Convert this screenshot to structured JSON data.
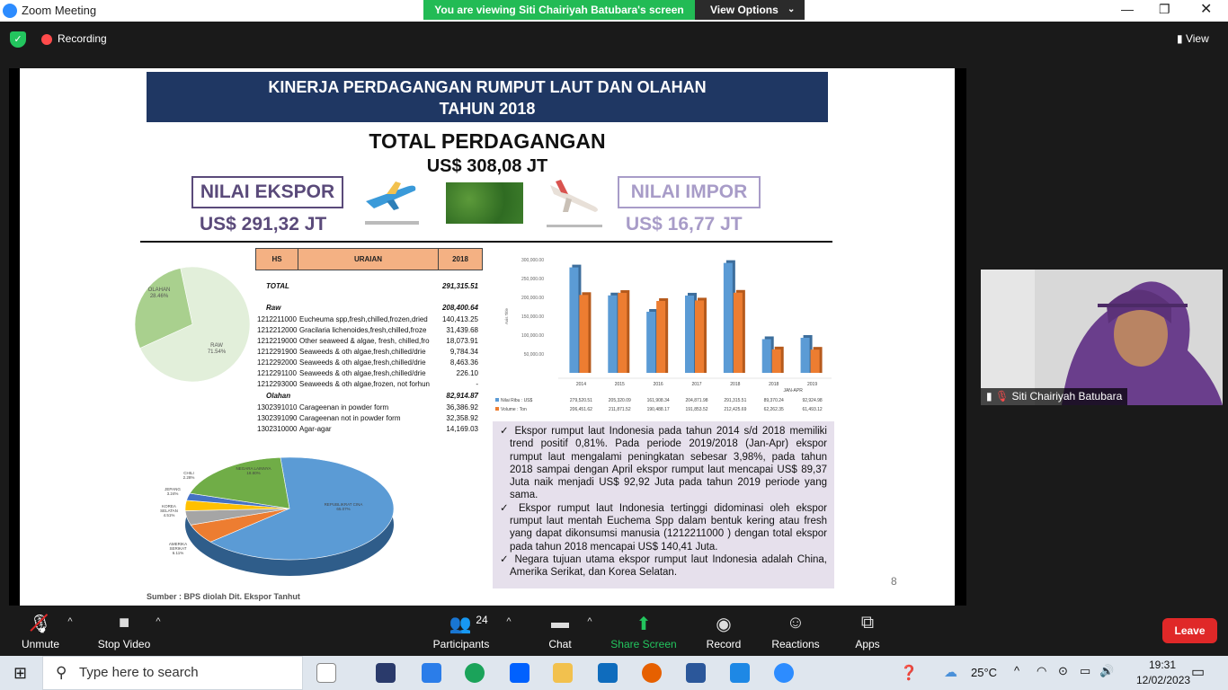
{
  "window": {
    "title": "Zoom Meeting",
    "banner": "You are viewing Siti Chairiyah Batubara's screen",
    "view_options": "View Options"
  },
  "topbar": {
    "recording": "Recording",
    "view": "View"
  },
  "slide": {
    "header_line1": "KINERJA PERDAGANGAN RUMPUT LAUT DAN OLAHAN",
    "header_line2": "TAHUN 2018",
    "total_title": "TOTAL PERDAGANGAN",
    "total_value": "US$ 308,08 JT",
    "export_label": "NILAI EKSPOR",
    "export_value": "US$ 291,32 JT",
    "import_label": "NILAI IMPOR",
    "import_value": "US$ 16,77 JT",
    "table_headers": [
      "HS",
      "URAIAN",
      "2018"
    ],
    "table_rows": [
      {
        "hs": "TOTAL",
        "desc": "",
        "val": "291,315.51",
        "style": "total"
      },
      {
        "hs": "Raw",
        "desc": "",
        "val": "208,400.64",
        "style": "group"
      },
      {
        "hs": "1212211000",
        "desc": "Eucheuma spp,fresh,chilled,frozen,dried",
        "val": "140,413.25",
        "style": ""
      },
      {
        "hs": "1212212000",
        "desc": "Gracilaria lichenoides,fresh,chilled,froze",
        "val": "31,439.68",
        "style": ""
      },
      {
        "hs": "1212219000",
        "desc": "Other seaweed & algae, fresh, chilled,fro",
        "val": "18,073.91",
        "style": ""
      },
      {
        "hs": "1212291900",
        "desc": "Seaweeds & oth algae,fresh,chilled/drie",
        "val": "9,784.34",
        "style": ""
      },
      {
        "hs": "1212292000",
        "desc": "Seaweeds & oth algae,fresh,chilled/drie",
        "val": "8,463.36",
        "style": ""
      },
      {
        "hs": "1212291100",
        "desc": "Seaweeds & oth algae,fresh,chilled/drie",
        "val": "226.10",
        "style": ""
      },
      {
        "hs": "1212293000",
        "desc": "Seaweeds & oth algae,frozen, not forhun",
        "val": "-",
        "style": ""
      },
      {
        "hs": "Olahan",
        "desc": "",
        "val": "82,914.87",
        "style": "group"
      },
      {
        "hs": "1302391010",
        "desc": "Carageenan in powder form",
        "val": "36,386.92",
        "style": ""
      },
      {
        "hs": "1302391090",
        "desc": "Carageenan not in powder form",
        "val": "32,358.92",
        "style": ""
      },
      {
        "hs": "1302310000",
        "desc": "Agar-agar",
        "val": "14,169.03",
        "style": ""
      }
    ],
    "bullets": [
      "Ekspor rumput laut Indonesia pada tahun 2014 s/d 2018 memiliki trend positif 0,81%. Pada periode 2019/2018 (Jan-Apr) ekspor rumput laut mengalami peningkatan sebesar 3,98%, pada tahun 2018 sampai dengan April ekspor rumput laut mencapai US$ 89,37 Juta naik menjadi US$ 92,92 Juta pada tahun 2019 periode yang sama.",
      "Ekspor rumput laut Indonesia tertinggi didominasi oleh ekspor rumput laut mentah Euchema Spp dalam bentuk kering atau fresh yang dapat dikonsumsi manusia (1212211000 ) dengan total ekspor pada tahun 2018 mencapai US$ 140,41 Juta.",
      "Negara tujuan   utama ekspor rumput laut Indonesia adalah China, Amerika Serikat, dan Korea Selatan."
    ],
    "source": "Sumber : BPS diolah Dit. Ekspor Tanhut",
    "page_number": "8"
  },
  "chart_data": [
    {
      "type": "pie",
      "labels": [
        "RAW",
        "OLAHAN"
      ],
      "label_values": [
        "71.54%",
        "28.46%"
      ],
      "values": [
        71.54,
        28.46
      ],
      "colors": [
        "#e2efda",
        "#a9d08e"
      ]
    },
    {
      "type": "pie",
      "labels": [
        "REPUBLIKRAT CINA",
        "AMERIKA SERIKAT",
        "KOREA SELATAN",
        "JEPANG",
        "CHILI",
        "NEGARA LAINNYA"
      ],
      "label_values": [
        "65.07%",
        "6.11%",
        "4.51%",
        "3.24%",
        "2.28%",
        "18.80%"
      ],
      "values": [
        65.07,
        6.11,
        4.51,
        3.24,
        2.28,
        18.8
      ],
      "colors": [
        "#5b9bd5",
        "#ed7d31",
        "#a5a5a5",
        "#ffc000",
        "#4472c4",
        "#70ad47"
      ]
    },
    {
      "type": "bar",
      "categories": [
        "2014",
        "2015",
        "2016",
        "2017",
        "2018",
        "2018",
        "2019"
      ],
      "group_label": "JAN-APR",
      "ylabel": "Axis Title",
      "ylim": [
        0,
        300000
      ],
      "yticks": [
        "50,000.00",
        "100,000.00",
        "150,000.00",
        "200,000.00",
        "250,000.00",
        "300,000.00"
      ],
      "series": [
        {
          "name": "Nilai Ribu : US$",
          "values": [
            279520.51,
            205320.09,
            161908.34,
            204871.98,
            291315.51,
            89370.24,
            92924.98
          ],
          "labels": [
            "279,520.51",
            "205,320.09",
            "161,908.34",
            "204,871.98",
            "291,315.51",
            "89,370.24",
            "92,924.98"
          ],
          "color": "#5b9bd5"
        },
        {
          "name": "Volume : Ton",
          "values": [
            206451.62,
            211871.52,
            190488.17,
            191853.52,
            212425.69,
            62262.35,
            61493.12
          ],
          "labels": [
            "206,451.62",
            "211,871.52",
            "190,488.17",
            "191,853.52",
            "212,425.69",
            "62,262.35",
            "61,493.12"
          ],
          "color": "#ed7d31"
        }
      ]
    }
  ],
  "participant": {
    "name": "Siti Chairiyah Batubara"
  },
  "toolbar": {
    "unmute": "Unmute",
    "stop_video": "Stop Video",
    "participants": "Participants",
    "participants_count": "24",
    "chat": "Chat",
    "share": "Share Screen",
    "record": "Record",
    "reactions": "Reactions",
    "apps": "Apps",
    "leave": "Leave"
  },
  "taskbar": {
    "search_placeholder": "Type here to search",
    "temp": "25°C",
    "time": "19:31",
    "date": "12/02/2023"
  }
}
